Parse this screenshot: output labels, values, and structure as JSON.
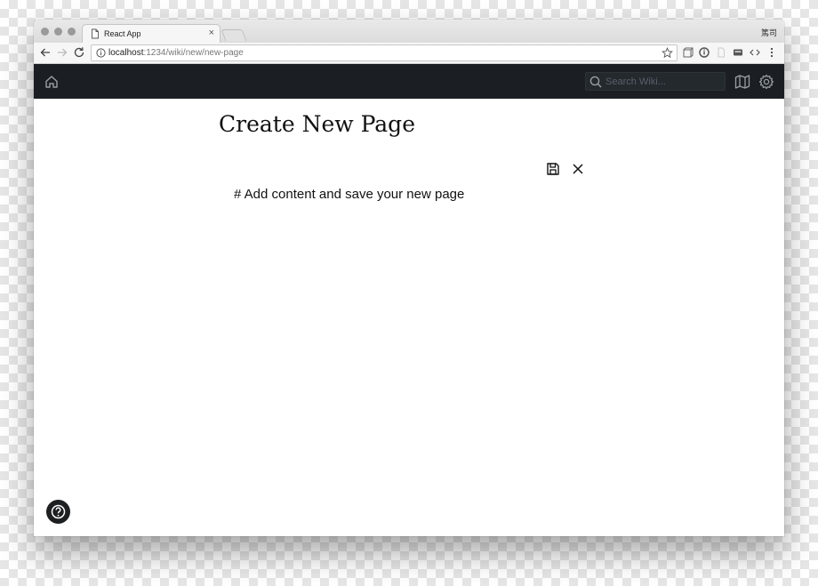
{
  "browser": {
    "tab_title": "React App",
    "tab_close": "×",
    "profile_name": "篤司",
    "url_host": "localhost",
    "url_path": ":1234/wiki/new/new-page"
  },
  "navbar": {
    "search_placeholder": "Search Wiki..."
  },
  "page": {
    "title": "Create New Page",
    "editor_content": "# Add content and save your new page"
  },
  "colors": {
    "navbar_bg": "#1b1f23",
    "nav_icon": "#9aa0a6",
    "text": "#111111"
  },
  "icons": [
    "document-icon",
    "back-icon",
    "forward-icon",
    "reload-icon",
    "info-icon",
    "star-icon",
    "home-icon",
    "search-icon",
    "map-icon",
    "gear-icon",
    "save-icon",
    "close-icon",
    "help-icon"
  ]
}
